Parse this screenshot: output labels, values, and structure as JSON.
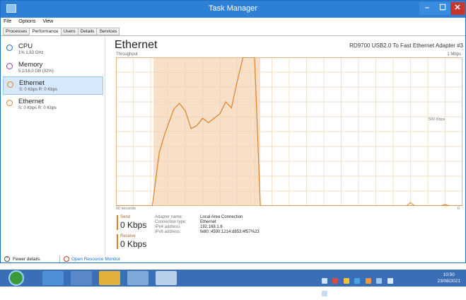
{
  "window": {
    "title": "Task Manager",
    "buttons": {
      "minimize": "–",
      "maximize": "☐",
      "close": "✕"
    }
  },
  "menu": [
    "File",
    "Options",
    "View"
  ],
  "tabs": [
    "Processes",
    "Performance",
    "Users",
    "Details",
    "Services"
  ],
  "active_tab": "Performance",
  "sidebar": {
    "items": [
      {
        "name": "CPU",
        "sub": "1% 1,63 GHz",
        "color": "#1e6fc2",
        "selected": false
      },
      {
        "name": "Memory",
        "sub": "5,1/16,0 GB (32%)",
        "color": "#8a3fb8",
        "selected": false
      },
      {
        "name": "Ethernet",
        "sub": "S: 0 Kbps R: 0 Kbps",
        "color": "#d9822b",
        "selected": true
      },
      {
        "name": "Ethernet",
        "sub": "S: 0 Kbps R: 0 Kbps",
        "color": "#d9822b",
        "selected": false
      }
    ]
  },
  "main": {
    "title": "Ethernet",
    "adapter": "RD9700 USB2.0 To Fast Ethernet Adapter #3",
    "throughput_label": "Throughput",
    "max_label": "1 Mbps",
    "mid_label": "500 Kbps",
    "time_label": "60 seconds",
    "zero_label": "0"
  },
  "chart_data": {
    "type": "line",
    "ylim": [
      0,
      1000
    ],
    "x": [
      0,
      4,
      8,
      12,
      16,
      20,
      24,
      28,
      32,
      36,
      40,
      44,
      48,
      52,
      56,
      60
    ],
    "series": [
      {
        "points": [
          [
            0,
            0
          ],
          [
            6.3,
            0
          ],
          [
            7.5,
            360
          ],
          [
            8.5,
            490
          ],
          [
            10,
            650
          ],
          [
            11,
            690
          ],
          [
            12,
            640
          ],
          [
            13,
            520
          ],
          [
            14,
            540
          ],
          [
            15,
            590
          ],
          [
            16,
            560
          ],
          [
            18,
            620
          ],
          [
            19,
            700
          ],
          [
            20,
            660
          ],
          [
            21,
            840
          ],
          [
            22,
            1000
          ],
          [
            23,
            1000
          ],
          [
            24,
            1000
          ],
          [
            25,
            0
          ],
          [
            60,
            0
          ]
        ]
      }
    ],
    "blips": [
      [
        51,
        22
      ],
      [
        57,
        10
      ]
    ],
    "highlight_range": [
      6.5,
      25
    ],
    "colors": {
      "line": "#d9822b",
      "fill": "#f7dfc8",
      "grid": "#f3d3b4",
      "border": "#e6b48a"
    }
  },
  "details": {
    "send_label": "Send",
    "send_value": "0 Kbps",
    "receive_label": "Receive",
    "receive_value": "0 Kbps",
    "rows": [
      {
        "k": "Adapter name:",
        "v": "Local Area Connection"
      },
      {
        "k": "Connection type:",
        "v": "Ethernet"
      },
      {
        "k": "IPv4 address:",
        "v": "192.168.1.6"
      },
      {
        "k": "IPv6 address:",
        "v": "fe80::4590:1214:d853:4f57%23"
      }
    ]
  },
  "footer": {
    "fewer_details": "Fewer details",
    "open_monitor": "Open Resource Monitor"
  },
  "taskbar": {
    "time": "10:50",
    "date": "23/08/2021",
    "buttons": [
      "task-manager-icon",
      "explorer-icon",
      "folder-icon",
      "network-icon",
      "taskmgr-window-icon"
    ]
  }
}
